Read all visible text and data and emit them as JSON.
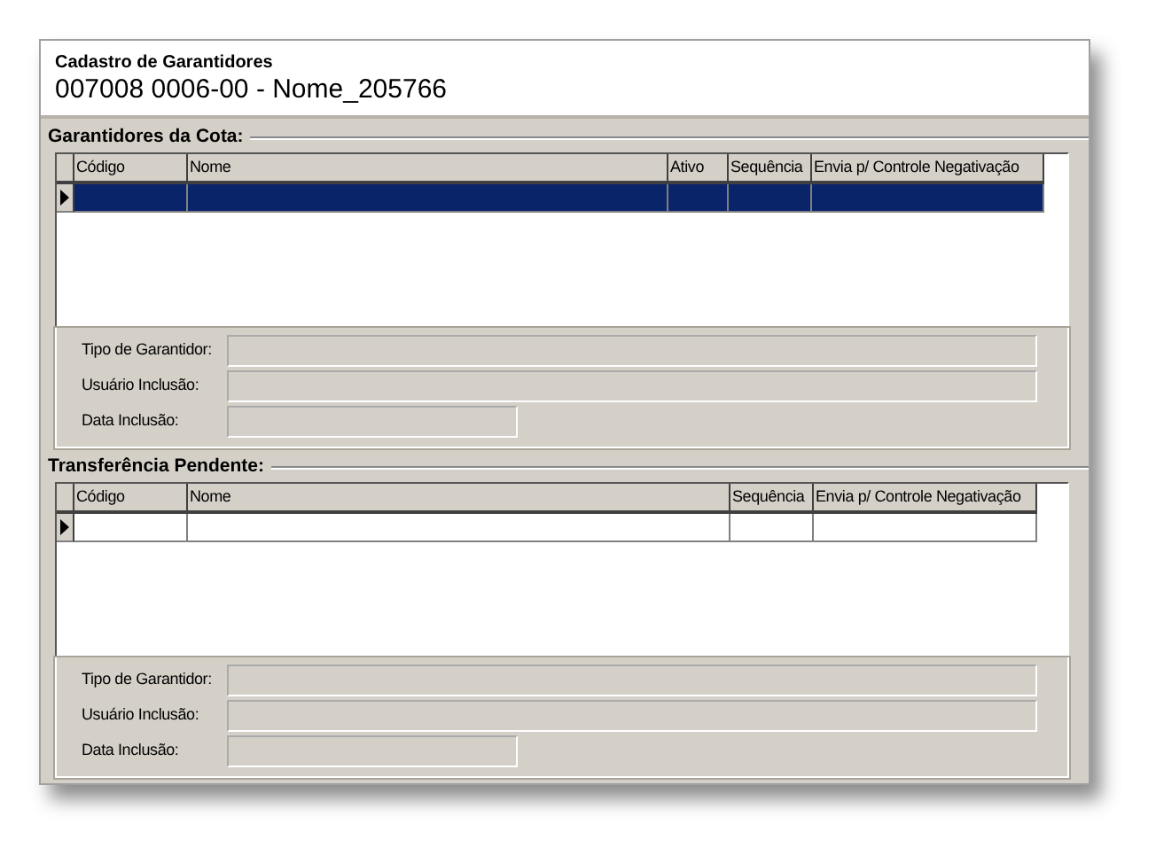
{
  "header": {
    "title": "Cadastro de Garantidores",
    "subtitle": "007008 0006-00 - Nome_205766"
  },
  "sections": [
    {
      "title": "Garantidores da Cota:",
      "columns": [
        "Código",
        "Nome",
        "Ativo",
        "Sequência",
        "Envia p/ Controle Negativação"
      ],
      "rows": [
        {
          "selected": true
        }
      ],
      "fields": [
        {
          "label": "Tipo de Garantidor:",
          "kind": "long"
        },
        {
          "label": "Usuário Inclusão:",
          "kind": "long"
        },
        {
          "label": "Data Inclusão:",
          "kind": "short"
        }
      ]
    },
    {
      "title": "Transferência Pendente:",
      "columns": [
        "Código",
        "Nome",
        "Sequência",
        "Envia p/ Controle Negativação"
      ],
      "rows": [
        {
          "selected": false
        }
      ],
      "fields": [
        {
          "label": "Tipo de Garantidor:",
          "kind": "long"
        },
        {
          "label": "Usuário Inclusão:",
          "kind": "long"
        },
        {
          "label": "Data Inclusão:",
          "kind": "short"
        }
      ]
    }
  ]
}
